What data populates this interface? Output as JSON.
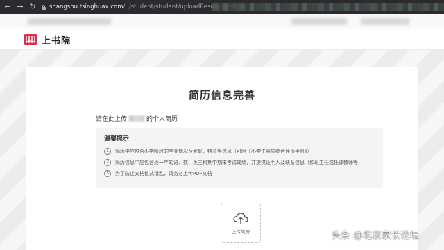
{
  "browser": {
    "back_icon": "arrow-left-icon",
    "forward_icon": "arrow-right-icon",
    "reload_icon": "reload-icon",
    "url_host": "shangshu.tsinghuax.com",
    "url_path": "/u/student/student/uploadResume.action"
  },
  "header": {
    "logo_text": "上书院",
    "brand_color": "#d8304a"
  },
  "main": {
    "title": "简历信息完善",
    "intro_prefix": "请在此上传",
    "intro_suffix": "的个人简历",
    "tips": {
      "title": "温馨提示",
      "items": [
        {
          "num": "1",
          "text": "简历中应包含小学阶段的学业情况及爱好、特长等信息（可附《小学生素质综合评价手册》）"
        },
        {
          "num": "2",
          "text": "简历信息中应包含近一年的语、数、英三科期中期末考试成绩，并提供证明人及联系信息（如班主任或任课教师等）"
        },
        {
          "num": "3",
          "text": "为了防止文档格式错乱，请务必上传PDF文档"
        }
      ]
    },
    "upload": {
      "label": "上传简历",
      "icon": "cloud-upload-icon"
    }
  },
  "watermark": {
    "text": "头条 @北京家长论坛"
  }
}
